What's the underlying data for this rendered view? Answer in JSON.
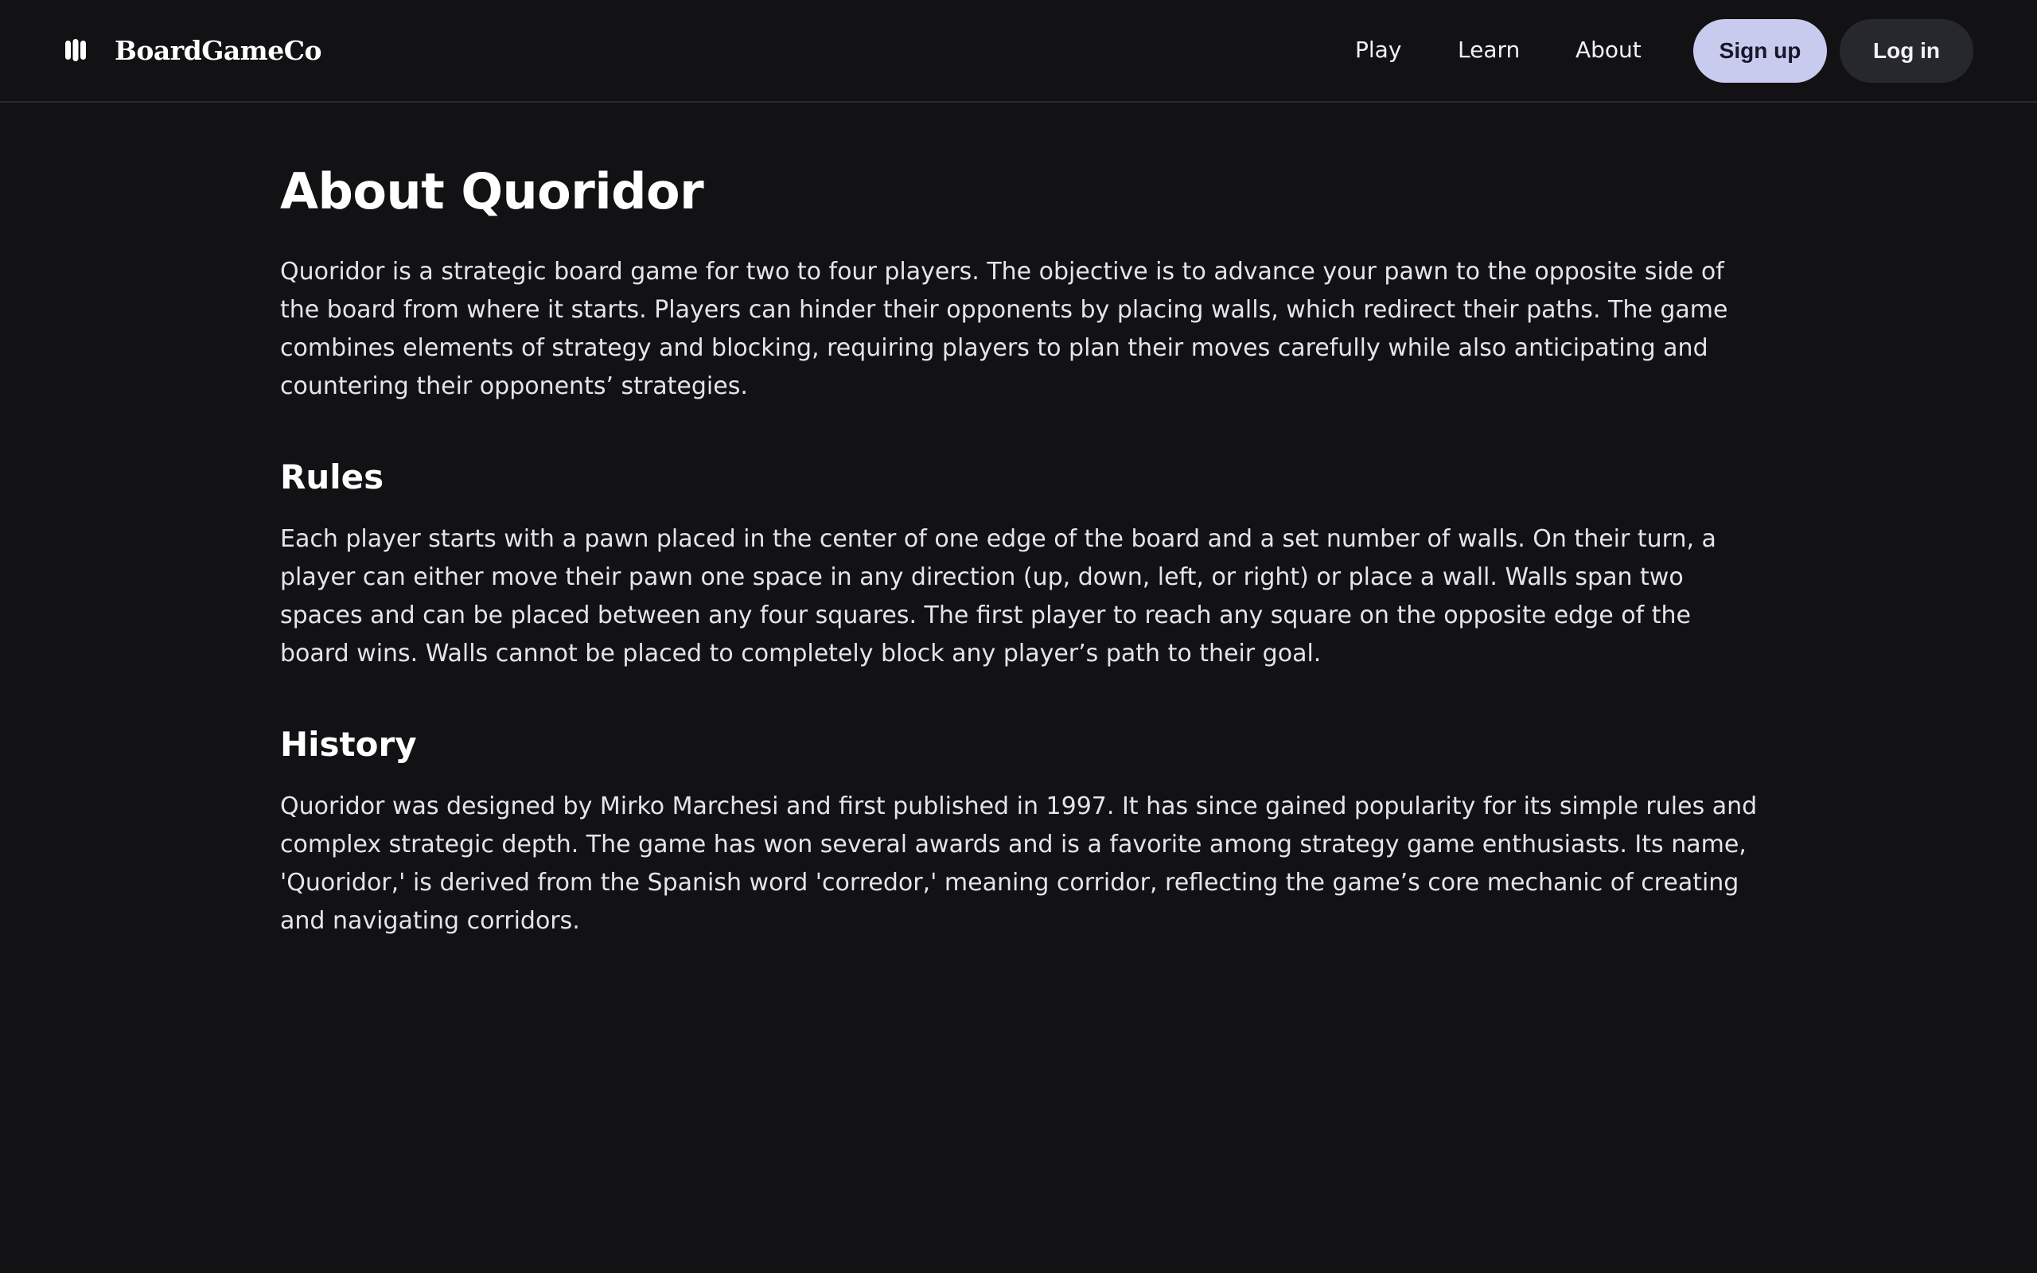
{
  "brand": {
    "name": "BoardGameCo",
    "icon": "logo-icon"
  },
  "nav": {
    "links": [
      "Play",
      "Learn",
      "About"
    ],
    "signup_label": "Sign up",
    "login_label": "Log in"
  },
  "colors": {
    "background": "#121214",
    "signup_bg": "#C9CBEE",
    "login_bg": "#26282E",
    "text": "#ECEDEF"
  },
  "content": {
    "title": "About Quoridor",
    "intro": "Quoridor is a strategic board game for two to four players. The objective is to advance your pawn to the opposite side of the board from where it starts. Players can hinder their opponents by placing walls, which redirect their paths. The game combines elements of strategy and blocking, requiring players to plan their moves carefully while also anticipating and countering their opponents’ strategies.",
    "sections": [
      {
        "heading": "Rules",
        "body": "Each player starts with a pawn placed in the center of one edge of the board and a set number of walls. On their turn, a player can either move their pawn one space in any direction (up, down, left, or right) or place a wall. Walls span two spaces and can be placed between any four squares. The first player to reach any square on the opposite edge of the board wins. Walls cannot be placed to completely block any player’s path to their goal."
      },
      {
        "heading": "History",
        "body": "Quoridor was designed by Mirko Marchesi and first published in 1997. It has since gained popularity for its simple rules and complex strategic depth. The game has won several awards and is a favorite among strategy game enthusiasts. Its name, 'Quoridor,' is derived from the Spanish word 'corredor,' meaning corridor, reflecting the game’s core mechanic of creating and navigating corridors."
      }
    ]
  }
}
